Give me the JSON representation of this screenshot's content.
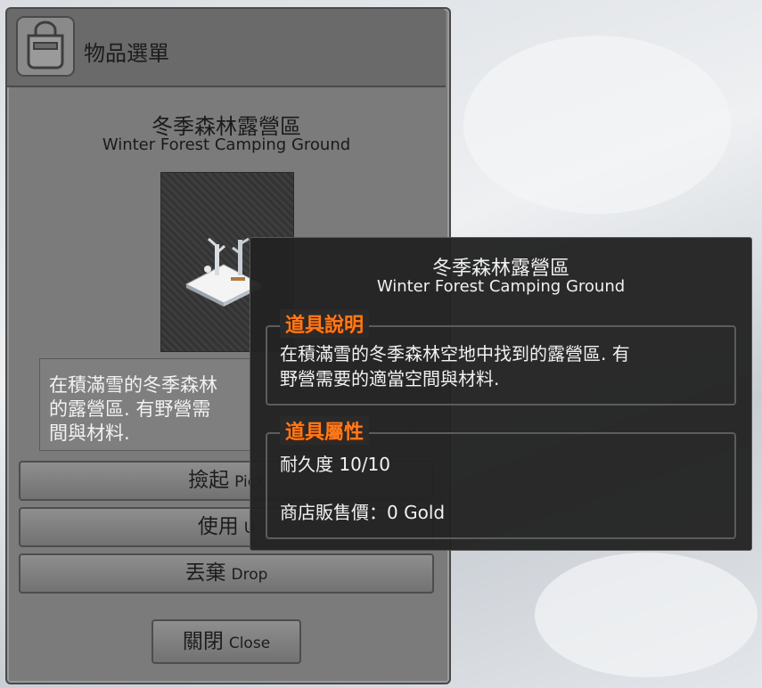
{
  "inventory": {
    "title": "物品選單",
    "item_name_zh": "冬季森林露營區",
    "item_name_en": "Winter Forest Camping Ground",
    "description_lines": [
      "在積滿雪的冬季森林",
      "的露營區.  有野營需",
      "間與材料."
    ],
    "buttons": [
      {
        "zh": "撿起",
        "en": "Pick"
      },
      {
        "zh": "使用",
        "en": "U"
      },
      {
        "zh": "丟棄",
        "en": "Drop"
      }
    ],
    "close": {
      "zh": "關閉",
      "en": "Close"
    }
  },
  "tooltip": {
    "name_zh": "冬季森林露營區",
    "name_en": "Winter Forest Camping Ground",
    "desc_label": "道具說明",
    "desc_lines": [
      "在積滿雪的冬季森林空地中找到的露營區. 有",
      "野營需要的適當空間與材料."
    ],
    "attr_label": "道具屬性",
    "durability": "耐久度 10/10",
    "shop_price": "商店販售價：0 Gold"
  },
  "colors": {
    "accent_label": "#ff7a1a"
  }
}
